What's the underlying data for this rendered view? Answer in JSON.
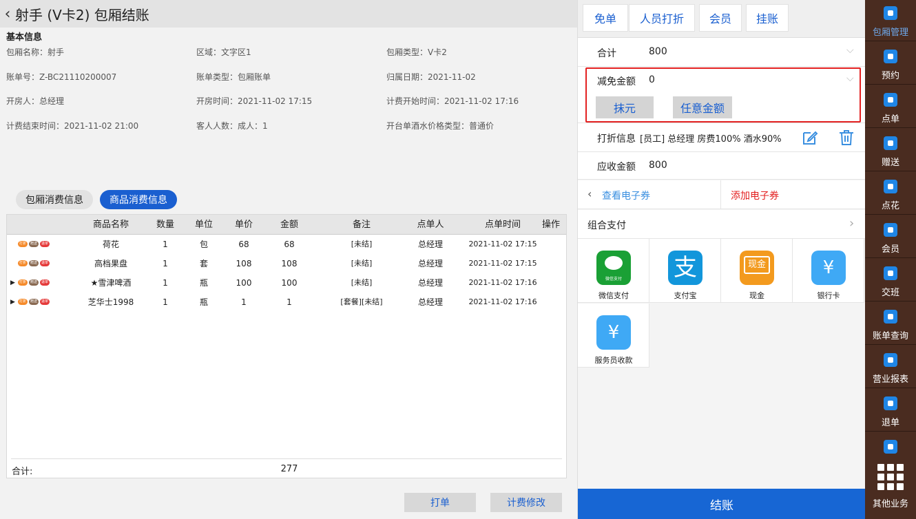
{
  "header": {
    "back_icon": "chevron-left-icon",
    "title": "射手 (V卡2) 包厢结账"
  },
  "basic_info": {
    "section_title": "基本信息",
    "fields": [
      "包厢名称：射手",
      "区域：文字区1",
      "包厢类型：V卡2",
      "账单号：Z-BC21110200007",
      "账单类型：包厢账单",
      "归属日期：2021-11-02",
      "开房人：总经理",
      "开房时间：2021-11-02 17:15",
      "计费开始时间：2021-11-02 17:16",
      "计费结束时间：2021-11-02 21:00",
      "客人人数：成人：1",
      "开台单酒水价格类型：普通价"
    ]
  },
  "tabs": [
    {
      "label": "包厢消费信息",
      "active": false
    },
    {
      "label": "商品消费信息",
      "active": true
    }
  ],
  "table": {
    "columns": [
      "商品名称",
      "数量",
      "单位",
      "单价",
      "金额",
      "备注",
      "点单人",
      "点单时间",
      "操作"
    ],
    "badges": [
      "打折",
      "赠送",
      "退单"
    ],
    "rows": [
      {
        "expand": "",
        "cells": [
          "荷花",
          "1",
          "包",
          "68",
          "68",
          "[未结]",
          "总经理",
          "2021-11-02 17:15",
          ""
        ]
      },
      {
        "expand": "",
        "cells": [
          "高档果盘",
          "1",
          "套",
          "108",
          "108",
          "[未结]",
          "总经理",
          "2021-11-02 17:15",
          ""
        ]
      },
      {
        "expand": "▶",
        "cells": [
          "★雪津啤酒",
          "1",
          "瓶",
          "100",
          "100",
          "[未结]",
          "总经理",
          "2021-11-02 17:16",
          ""
        ]
      },
      {
        "expand": "▶",
        "cells": [
          "芝华士1998",
          "1",
          "瓶",
          "1",
          "1",
          "[套餐][未结]",
          "总经理",
          "2021-11-02 17:16",
          ""
        ]
      }
    ],
    "footer_label": "合计:",
    "footer_total": "277"
  },
  "bottom_buttons": {
    "print": "打单",
    "billing_edit": "计费修改"
  },
  "actions": [
    "免单",
    "人员打折",
    "会员",
    "挂账"
  ],
  "summary": {
    "total_label": "合计",
    "total_value": "800",
    "discount_label": "减免金额",
    "discount_value": "0",
    "round_off": "抹元",
    "any_amount": "任意金额",
    "discount_info_label": "打折信息",
    "discount_info_value": "[员工] 总经理 房费100% 酒水90%",
    "receivable_label": "应收金额",
    "receivable_value": "800",
    "view_coupon": "查看电子券",
    "add_coupon": "添加电子券",
    "combo_pay": "组合支付"
  },
  "payments": [
    {
      "label": "微信支付",
      "icon": "wechat-pay-icon",
      "icon_text": "微信支付",
      "color": "#1aa035"
    },
    {
      "label": "支付宝",
      "icon": "alipay-icon",
      "icon_text": "支",
      "color": "#1296db"
    },
    {
      "label": "现金",
      "icon": "cash-icon",
      "icon_text": "现金",
      "color": "#f39a1e"
    },
    {
      "label": "银行卡",
      "icon": "bank-card-icon",
      "icon_text": "¥",
      "color": "#3fa9f5"
    },
    {
      "label": "服务员收款",
      "icon": "waiter-collect-icon",
      "icon_text": "¥",
      "color": "#3fa9f5"
    }
  ],
  "checkout_label": "结账",
  "sidebar": {
    "items": [
      {
        "label": "包厢管理",
        "icon": "room-management-icon",
        "active": true
      },
      {
        "label": "预约",
        "icon": "reservation-icon",
        "active": false
      },
      {
        "label": "点单",
        "icon": "order-icon",
        "active": false
      },
      {
        "label": "赠送",
        "icon": "gift-icon",
        "active": false
      },
      {
        "label": "点花",
        "icon": "flower-icon",
        "active": false
      },
      {
        "label": "会员",
        "icon": "member-icon",
        "active": false
      },
      {
        "label": "交班",
        "icon": "shift-icon",
        "active": false
      },
      {
        "label": "账单查询",
        "icon": "bill-query-icon",
        "active": false
      },
      {
        "label": "营业报表",
        "icon": "report-icon",
        "active": false
      },
      {
        "label": "退单",
        "icon": "refund-icon",
        "active": false
      }
    ],
    "other_label": "其他业务"
  },
  "colors": {
    "accent": "#1766d4",
    "highlight_border": "#e32020",
    "sidebar": "#4a2c20",
    "add_coupon": "#e32020"
  }
}
